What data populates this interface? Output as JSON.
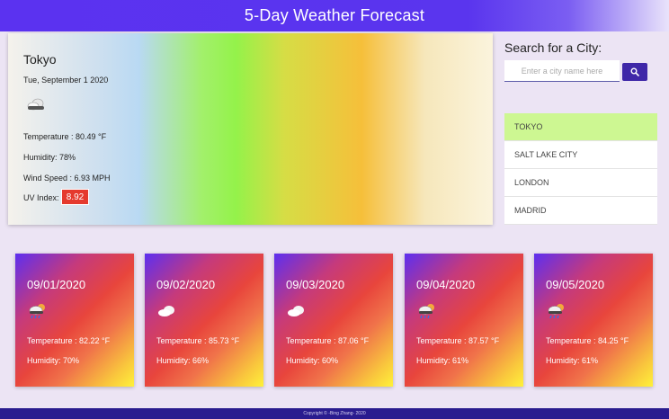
{
  "header": {
    "title": "5-Day Weather Forecast"
  },
  "current": {
    "city": "Tokyo",
    "date": "Tue, September 1 2020",
    "icon": "cloud-icon",
    "temperature": "Temperature : 80.49 °F",
    "humidity": "Humidity: 78%",
    "wind": "Wind Speed : 6.93 MPH",
    "uv_label": "UV Index:",
    "uv_value": "8.92",
    "uv_color": "#e53a2e"
  },
  "search": {
    "title": "Search for a City:",
    "placeholder": "Enter a city name here",
    "button_icon": "search-icon"
  },
  "history": [
    {
      "label": "TOKYO",
      "active": true
    },
    {
      "label": "SALT LAKE CITY",
      "active": false
    },
    {
      "label": "LONDON",
      "active": false
    },
    {
      "label": "MADRID",
      "active": false
    }
  ],
  "forecast": [
    {
      "date": "09/01/2020",
      "icon": "rain-cloud-icon",
      "temp": "Temperature : 82.22 °F",
      "humidity": "Humidity: 70%"
    },
    {
      "date": "09/02/2020",
      "icon": "cloud-icon",
      "temp": "Temperature : 85.73 °F",
      "humidity": "Humidity: 66%"
    },
    {
      "date": "09/03/2020",
      "icon": "cloud-icon",
      "temp": "Temperature : 87.06 °F",
      "humidity": "Humidity: 60%"
    },
    {
      "date": "09/04/2020",
      "icon": "rain-cloud-icon",
      "temp": "Temperature : 87.57 °F",
      "humidity": "Humidity: 61%"
    },
    {
      "date": "09/05/2020",
      "icon": "rain-cloud-icon",
      "temp": "Temperature : 84.25 °F",
      "humidity": "Humidity: 61%"
    }
  ],
  "footer": {
    "text": "Copyright © -Bing Zhang- 2020"
  },
  "colors": {
    "accent": "#3f27a8",
    "header": "#5b32f0",
    "active_history": "#cdf792"
  }
}
